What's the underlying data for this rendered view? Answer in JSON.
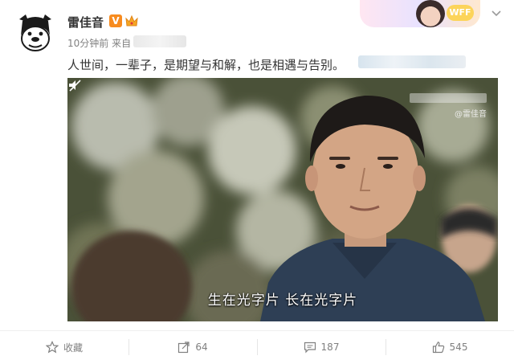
{
  "author": {
    "name": "雷佳音",
    "verified_label": "V",
    "avatar_icon": "bulldog-avatar-icon",
    "crown_icon": "crown-icon"
  },
  "meta": {
    "time_and_source": "10分钟前 来自"
  },
  "post": {
    "text": "人世间，一辈子，是期望与和解，也是相遇与告别。"
  },
  "video": {
    "watermark": "@雷佳音",
    "subtitle": "生在光字片  长在光字片",
    "mute_icon": "mute-icon"
  },
  "decoration": {
    "badge_text": "WFF"
  },
  "actions": {
    "favorite_label": "收藏",
    "repost_count": "64",
    "comment_count": "187",
    "like_count": "545"
  },
  "colors": {
    "verified_badge": "#f78b1f",
    "meta_text": "#808080",
    "body_text": "#333333"
  }
}
